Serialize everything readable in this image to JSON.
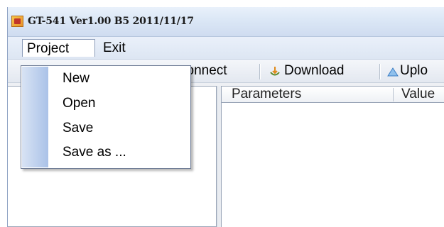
{
  "window": {
    "title": "GT-541 Ver1.00 B5 2011/11/17"
  },
  "menubar": {
    "items": [
      {
        "label": "Project"
      },
      {
        "label": "Exit"
      }
    ]
  },
  "project_menu": {
    "items": [
      {
        "label": "New"
      },
      {
        "label": "Open"
      },
      {
        "label": "Save"
      },
      {
        "label": "Save as ..."
      }
    ]
  },
  "toolbar": {
    "connect_label": "connect",
    "download_label": "Download",
    "upload_label": "Uplo",
    "download_icon": "download-icon",
    "upload_icon": "upload-icon"
  },
  "grid": {
    "columns": [
      {
        "label": "Parameters"
      },
      {
        "label": "Value"
      }
    ]
  },
  "colors": {
    "menu_gutter": "#aac2e8",
    "titlebar": "#dbe7f6"
  }
}
